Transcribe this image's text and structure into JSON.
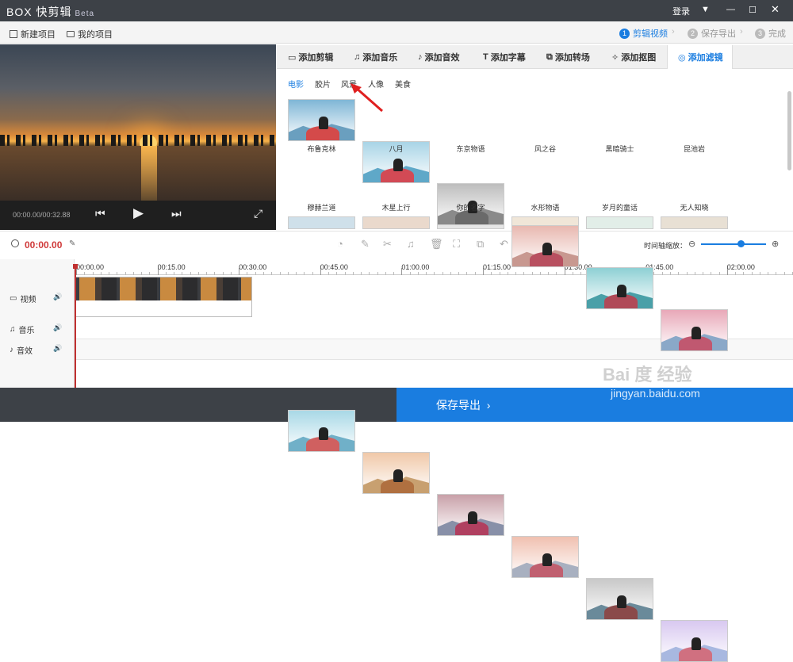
{
  "app": {
    "logo": "BOX",
    "title": "快剪辑",
    "beta": "Beta",
    "login": "登录"
  },
  "menu": {
    "new_project": "新建项目",
    "my_projects": "我的项目"
  },
  "steps": [
    {
      "num": "1",
      "label": "剪辑视频"
    },
    {
      "num": "2",
      "label": "保存导出"
    },
    {
      "num": "3",
      "label": "完成"
    }
  ],
  "player": {
    "time": "00:00.00/00:32.88"
  },
  "tabs": [
    "添加剪辑",
    "添加音乐",
    "添加音效",
    "添加字幕",
    "添加转场",
    "添加抠图",
    "添加滤镜"
  ],
  "filter_categories": [
    "电影",
    "胶片",
    "风景",
    "人像",
    "美食"
  ],
  "filters_row1": [
    "布鲁克林",
    "八月",
    "东京物语",
    "风之谷",
    "黑暗骑士",
    "昆池岩"
  ],
  "filters_row2": [
    "穆赫兰道",
    "木星上行",
    "你的名字",
    "水形物语",
    "岁月的童话",
    "无人知晓"
  ],
  "timeline": {
    "current": "00:00.00",
    "zoom_label": "时间轴缩放：",
    "ticks": [
      "00:00.00",
      "00:15.00",
      "00:30.00",
      "00:45.00",
      "01:00.00",
      "01:15.00",
      "01:30.00",
      "01:45.00",
      "02:00.00"
    ]
  },
  "tracks": {
    "video": "视频",
    "music": "音乐",
    "sfx": "音效"
  },
  "footer": {
    "save": "保存导出"
  },
  "watermark": {
    "line1": "Bai 度 经验",
    "line2": "jingyan.baidu.com"
  },
  "colors": {
    "accent": "#1a7de0",
    "title_bg": "#3d4147",
    "time_red": "#d03a3a"
  }
}
